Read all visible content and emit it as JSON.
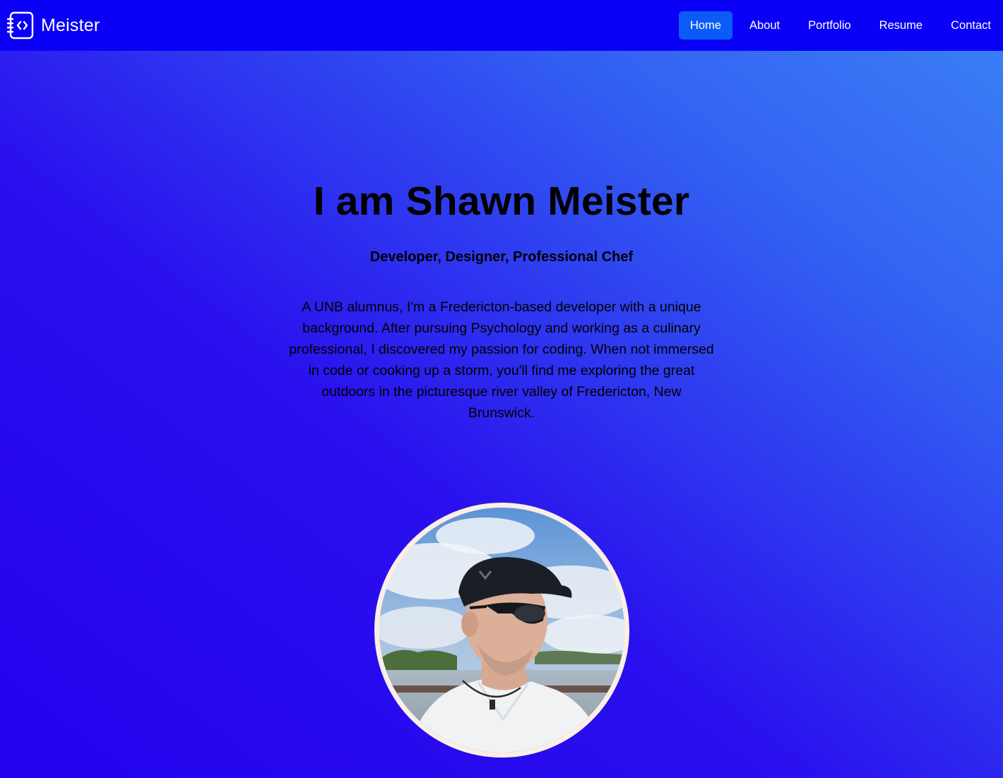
{
  "navbar": {
    "brand": {
      "icon": "code-notebook-icon",
      "name": "Meister"
    },
    "links": [
      {
        "label": "Home",
        "active": true
      },
      {
        "label": "About",
        "active": false
      },
      {
        "label": "Portfolio",
        "active": false
      },
      {
        "label": "Resume",
        "active": false
      },
      {
        "label": "Contact",
        "active": false
      }
    ]
  },
  "hero": {
    "title": "I am Shawn Meister",
    "subtitle": "Developer, Designer, Professional Chef",
    "bio": "A UNB alumnus, I'm a Fredericton-based developer with a unique background. After pursuing Psychology and working as a culinary professional, I discovered my passion for coding. When not immersed in code or cooking up a storm, you'll find me exploring the great outdoors in the picturesque river valley of Fredericton, New Brunswick."
  },
  "colors": {
    "navbar_bg": "#0a00f5",
    "active_link_bg": "#0b5cf7",
    "gradient_start": "#2300ee",
    "gradient_end": "#3c82f6",
    "avatar_border": "#fbeee6"
  }
}
